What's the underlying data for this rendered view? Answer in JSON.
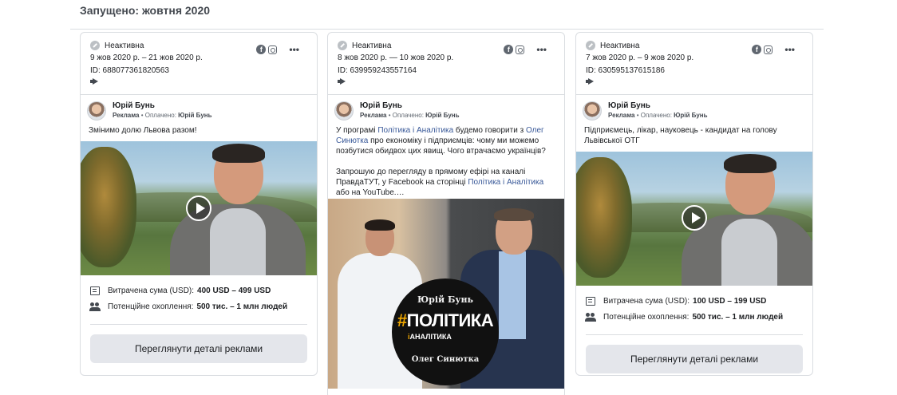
{
  "section_title": "Запущено: жовтня 2020",
  "ads": [
    {
      "status": "Неактивна",
      "dates": "9 жов 2020 р. – 21 жов 2020 р.",
      "id": "ID: 688077361820563",
      "advertiser": "Юрій Бунь",
      "sponsor_label": "Реклама",
      "paid_by_prefix": "Оплачено: ",
      "paid_by": "Юрій Бунь",
      "text": "Змінимо долю Львова разом!",
      "spend_label": "Витрачена сума (USD):",
      "spend_value": "400 USD – 499 USD",
      "reach_label": "Потенційне охоплення:",
      "reach_value": "500 тис. – 1 млн людей",
      "button": "Переглянути деталі реклами"
    },
    {
      "status": "Неактивна",
      "dates": "8 жов 2020 р. — 10 жов 2020 р.",
      "id": "ID: 639959243557164",
      "advertiser": "Юрій Бунь",
      "sponsor_label": "Реклама",
      "paid_by_prefix": "Оплачено: ",
      "paid_by": "Юрій Бунь",
      "text_p1_a": "У програмі ",
      "text_p1_link1": "Політика і Аналітика",
      "text_p1_b": " будемо говорити з ",
      "text_p1_link2": "Олег Синютка",
      "text_p1_c": " про економіку і підприємців: чому ми можемо позбутися обидвох цих явищ. Чого втрачаємо українців?",
      "text_p2_a": "Запрошую до перегляду в прямому ефірі на каналі ПравдаТУТ, у Facebook на сторінці ",
      "text_p2_link": "Політика і Аналітика",
      "text_p2_b": " або на YouTube.…",
      "image_name1": "Юрій Бунь",
      "image_hash_mark": "#",
      "image_hash": "ПОЛІТИКА",
      "image_sub_mark": "і",
      "image_sub": "АНАЛІТИКА",
      "image_name2": "Олег Синютка"
    },
    {
      "status": "Неактивна",
      "dates": "7 жов 2020 р. – 9 жов 2020 р.",
      "id": "ID: 630595137615186",
      "advertiser": "Юрій Бунь",
      "sponsor_label": "Реклама",
      "paid_by_prefix": "Оплачено: ",
      "paid_by": "Юрій Бунь",
      "text": "Підприємець, лікар, науковець - кандидат на голову Львівської ОТГ",
      "spend_label": "Витрачена сума (USD):",
      "spend_value": "100 USD – 199 USD",
      "reach_label": "Потенційне охоплення:",
      "reach_value": "500 тис. – 1 млн людей",
      "button": "Переглянути деталі реклами"
    }
  ],
  "icons": {
    "facebook": "facebook-icon",
    "instagram": "instagram-icon",
    "more": "more-options-icon",
    "megaphone": "megaphone-icon",
    "play": "play-icon",
    "spend": "receipt-icon",
    "reach": "people-icon"
  }
}
